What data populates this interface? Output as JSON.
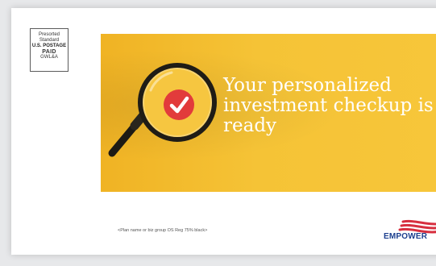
{
  "postage": {
    "line1": "Presorted",
    "line2": "Standard",
    "line3": "U.S. POSTAGE",
    "line4": "PAID",
    "line5": "GWL&A"
  },
  "banner": {
    "headline": "Your personalized investment checkup is ready",
    "background_color": "#f5c336",
    "icon": "magnifying-glass-icon",
    "check_icon": "check-icon",
    "check_color": "#e23b3b"
  },
  "footer": {
    "plan_placeholder": "<Plan name or biz group OS Reg 75% black>"
  },
  "logo": {
    "wordmark": "EMPOWER",
    "brand_blue": "#1b3e8e",
    "brand_red": "#d72f3f"
  }
}
